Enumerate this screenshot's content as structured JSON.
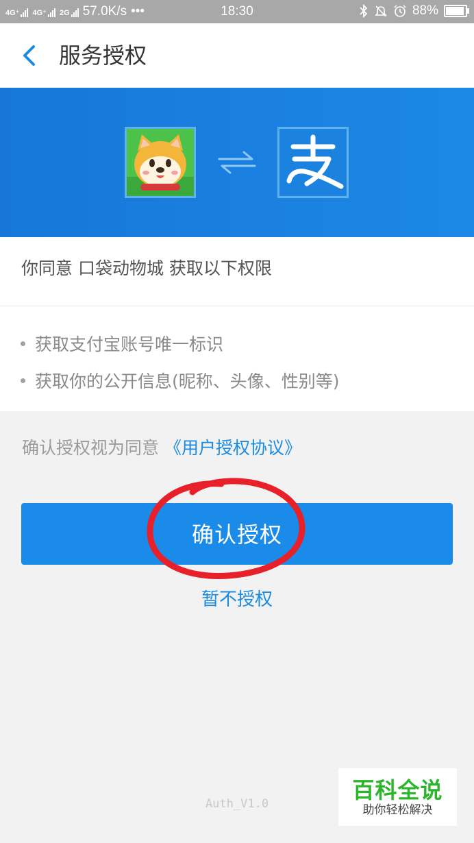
{
  "status_bar": {
    "network_1": "4G⁺",
    "network_2": "4G⁺",
    "network_3": "2G",
    "speed": "57.0K/s",
    "more": "•••",
    "time": "18:30",
    "battery": "88%",
    "battery_level": 0.88
  },
  "header": {
    "title": "服务授权",
    "back_icon": "chevron-left-icon"
  },
  "banner": {
    "app_icon": "shiba-dog-app-icon",
    "exchange_icon": "exchange-arrows-icon",
    "alipay_logo_text": "支",
    "colors": {
      "bg": "#1a85e2"
    }
  },
  "consent": {
    "text": "你同意 口袋动物城 获取以下权限",
    "permissions": [
      "获取支付宝账号唯一标识",
      "获取你的公开信息(昵称、头像、性别等)"
    ]
  },
  "agreement": {
    "prefix": "确认授权视为同意",
    "link": "《用户授权协议》"
  },
  "actions": {
    "confirm": "确认授权",
    "cancel": "暂不授权"
  },
  "version": "Auth_V1.0",
  "watermark": {
    "title": "百科全说",
    "subtitle": "助你轻松解决"
  },
  "colors": {
    "accent": "#1a8be8",
    "link": "#1b8be0",
    "annotation": "#e8202a"
  }
}
